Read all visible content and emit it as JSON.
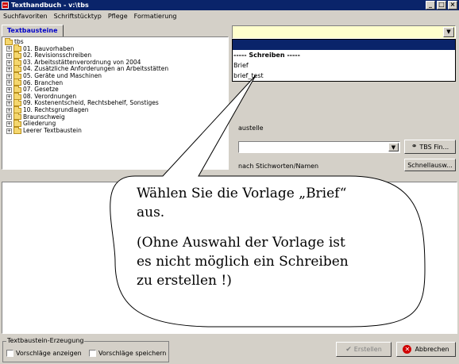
{
  "window": {
    "title": "Texthandbuch - v:\\tbs",
    "buttons": {
      "minimize": "_",
      "maximize": "□",
      "close": "×"
    }
  },
  "menubar": {
    "items": [
      "Suchfavoriten",
      "Schriftstücktyp",
      "Pflege",
      "Formatierung"
    ]
  },
  "left_panel": {
    "tab_label": "Textbausteine",
    "root": "tbs",
    "tree_items": [
      "01. Bauvorhaben",
      "02. Revisionsschreiben",
      "03. Arbeitsstättenverordnung von 2004",
      "04. Zusätzliche Anforderungen an Arbeitsstätten",
      "05. Geräte und Maschinen",
      "06. Branchen",
      "07. Gesetze",
      "08. Verordnungen",
      "09. Kostenentscheid, Rechtsbehelf, Sonstiges",
      "10. Rechtsgrundlagen",
      "Braunschweig",
      "Gliederung",
      "Leerer Textbaustein"
    ]
  },
  "right_panel": {
    "template_combo_value": "",
    "dropdown_items": [
      "",
      "----- Schreiben -----",
      "Brief",
      "brief_test"
    ],
    "label_baustelle": "austelle",
    "search_combo_value": "",
    "tbs_find_button": "TBS Fin...",
    "label_stichworte": "nach Stichworten/Namen",
    "quick_select_button": "Schnellausw..."
  },
  "footer": {
    "group_legend": "Textbaustein-Erzeugung",
    "checkbox_show": "Vorschläge anzeigen",
    "checkbox_save": "Vorschläge speichern",
    "create_button": "Erstellen",
    "cancel_button": "Abbrechen"
  },
  "callout": {
    "line1": "Wählen Sie die Vorlage „Brief“",
    "line2": "aus.",
    "line3": "(Ohne Auswahl der Vorlage ist",
    "line4": "es nicht möglich ein Schreiben",
    "line5": "zu erstellen !)"
  },
  "colors": {
    "titlebar": "#0a246a",
    "selection": "#0a246a",
    "combo_highlight": "#ffffcc",
    "tab_text": "#0000c8",
    "cancel_icon": "#d00000"
  }
}
